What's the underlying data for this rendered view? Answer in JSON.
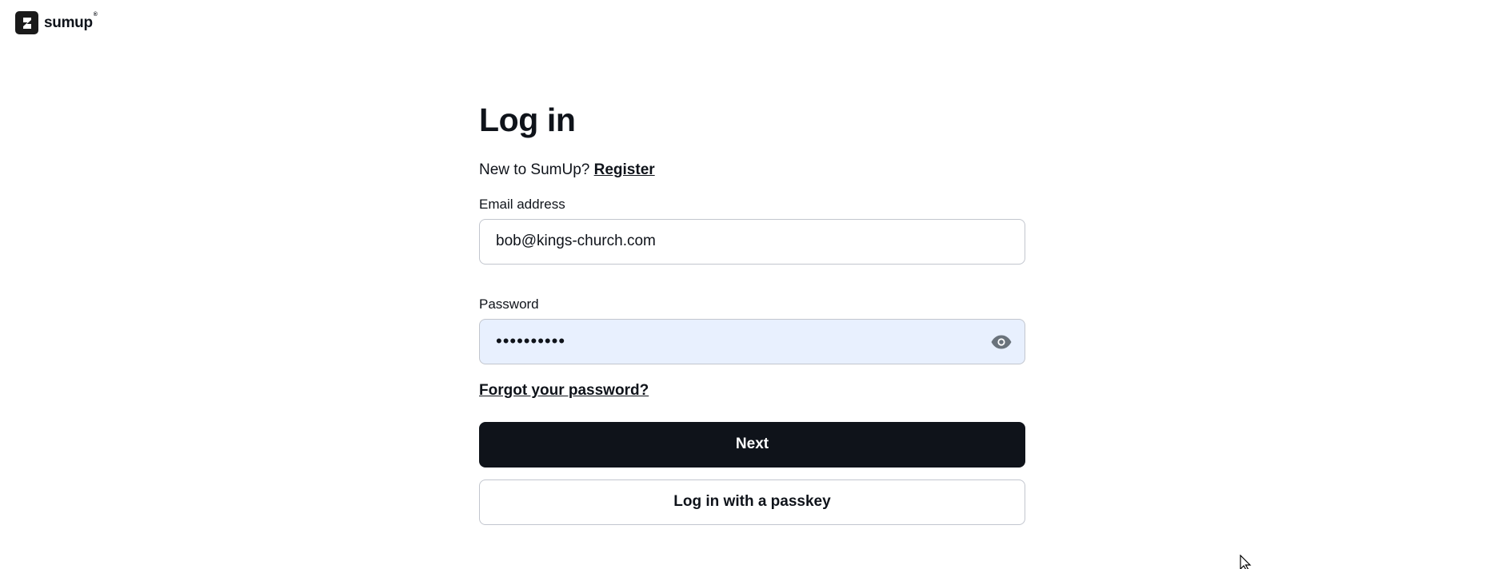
{
  "brand": {
    "logo_icon": "sumup-logo-icon",
    "wordmark": "sumup",
    "registered_mark": "®"
  },
  "login": {
    "title": "Log in",
    "new_prompt": "New to SumUp?",
    "register_link": "Register",
    "email": {
      "label": "Email address",
      "value": "bob@kings-church.com"
    },
    "password": {
      "label": "Password",
      "value": "password12",
      "toggle_icon": "eye-icon",
      "autofilled": true
    },
    "forgot_link": "Forgot your password?",
    "next_button": "Next",
    "passkey_button": "Log in with a passkey"
  },
  "colors": {
    "primary": "#0f131a",
    "border": "#c2c6ce",
    "autofill_bg": "#e8f0fe",
    "icon_gray": "#6a737c"
  }
}
